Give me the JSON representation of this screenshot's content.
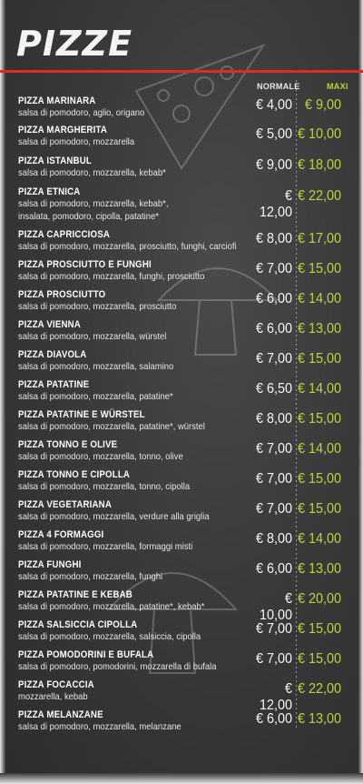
{
  "title": "Pizze",
  "columns": {
    "normale": "NORMALE",
    "maxi": "MAXI"
  },
  "items": [
    {
      "name": "Pizza Marinara",
      "desc": "salsa di pomodoro, aglio, origano",
      "normale": "€  4,00",
      "maxi": "€  9,00"
    },
    {
      "name": "Pizza Margherita",
      "desc": "salsa di pomodoro, mozzarella",
      "normale": "€  5,00",
      "maxi": "€ 10,00"
    },
    {
      "name": "Pizza Istanbul",
      "desc": "salsa di pomodoro, mozzarella, kebab*",
      "normale": "€  9,00",
      "maxi": "€ 18,00"
    },
    {
      "name": "Pizza Etnica",
      "desc": "salsa di pomodoro, mozzarella, kebab*,\ninsalata, pomodoro, cipolla, patatine*",
      "normale": "€ 12,00",
      "maxi": "€ 22,00"
    },
    {
      "name": "Pizza Capricciosa",
      "desc": "salsa di pomodoro, mozzarella, prosciutto, funghi, carciofi",
      "normale": "€  8,00",
      "maxi": "€ 17,00"
    },
    {
      "name": "Pizza Prosciutto e Funghi",
      "desc": "salsa di pomodoro, mozzarella, funghi, prosciutto",
      "normale": "€  7,00",
      "maxi": "€ 15,00"
    },
    {
      "name": "Pizza Prosciutto",
      "desc": "salsa di pomodoro, mozzarella, prosciutto",
      "normale": "€  6,00",
      "maxi": "€ 14,00"
    },
    {
      "name": "Pizza Vienna",
      "desc": "salsa di pomodoro, mozzarella, würstel",
      "normale": "€  6,00",
      "maxi": "€ 13,00"
    },
    {
      "name": "Pizza Diavola",
      "desc": "salsa di pomodoro, mozzarella, salamino",
      "normale": "€  7,00",
      "maxi": "€ 15,00"
    },
    {
      "name": "Pizza Patatine",
      "desc": "salsa di pomodoro, mozzarella, patatine*",
      "normale": "€  6,50",
      "maxi": "€ 14,00"
    },
    {
      "name": "Pizza Patatine e Würstel",
      "desc": "salsa di pomodoro, mozzarella, patatine*, würstel",
      "normale": "€  8,00",
      "maxi": "€ 15,00"
    },
    {
      "name": "Pizza Tonno e Olive",
      "desc": "salsa di pomodoro, mozzarella, tonno, olive",
      "normale": "€  7,00",
      "maxi": "€ 14,00"
    },
    {
      "name": "Pizza Tonno e Cipolla",
      "desc": "salsa di pomodoro, mozzarella, tonno, cipolla",
      "normale": "€  7,00",
      "maxi": "€ 15,00"
    },
    {
      "name": "Pizza Vegetariana",
      "desc": "salsa di pomodoro, mozzarella, verdure alla griglia",
      "normale": "€  7,00",
      "maxi": "€ 15,00"
    },
    {
      "name": "Pizza 4 Formaggi",
      "desc": "salsa di pomodoro, mozzarella, formaggi misti",
      "normale": "€  8,00",
      "maxi": "€ 14,00"
    },
    {
      "name": "Pizza Funghi",
      "desc": "salsa di pomodoro, mozzarella, funghi",
      "normale": "€  6,00",
      "maxi": "€ 13,00"
    },
    {
      "name": "Pizza Patatine e Kebab",
      "desc": "salsa di pomodoro, mozzarella, patatine*, kebab*",
      "normale": "€ 10,00",
      "maxi": "€ 20,00"
    },
    {
      "name": "Pizza Salsiccia Cipolla",
      "desc": "salsa di pomodoro, mozzarella, salsiccia, cipolla",
      "normale": "€  7,00",
      "maxi": "€ 15,00"
    },
    {
      "name": "Pizza Pomodorini e Bufala",
      "desc": "salsa di pomodoro, pomodorini, mozzarella di bufala",
      "normale": "€  7,00",
      "maxi": "€ 15,00"
    },
    {
      "name": "Pizza Focaccia",
      "desc": "mozzarella, kebab",
      "normale": "€ 12,00",
      "maxi": "€ 22,00"
    },
    {
      "name": "Pizza Melanzane",
      "desc": "salsa di pomodoro, mozzarella, melanzane",
      "normale": "€  6,00",
      "maxi": "€ 13,00"
    }
  ],
  "colors": {
    "accent_line": "#e02a26",
    "maxi_price": "#b6d636",
    "background": "#3a3a3a"
  },
  "icons": [
    "pizza-slice-doodle-icon",
    "mushroom-doodle-icon"
  ]
}
